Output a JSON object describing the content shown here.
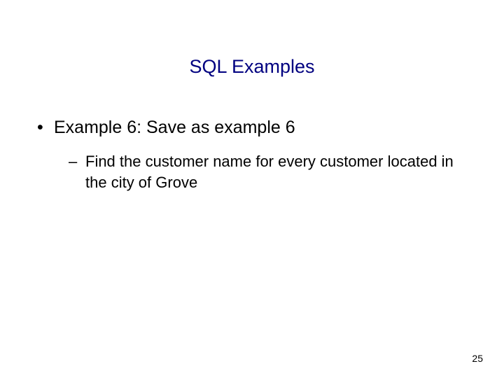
{
  "slide": {
    "title": "SQL Examples",
    "bullet1": "Example 6: Save as example 6",
    "bullet2": "Find the customer name for every customer located in the city of Grove",
    "pageNumber": "25"
  }
}
